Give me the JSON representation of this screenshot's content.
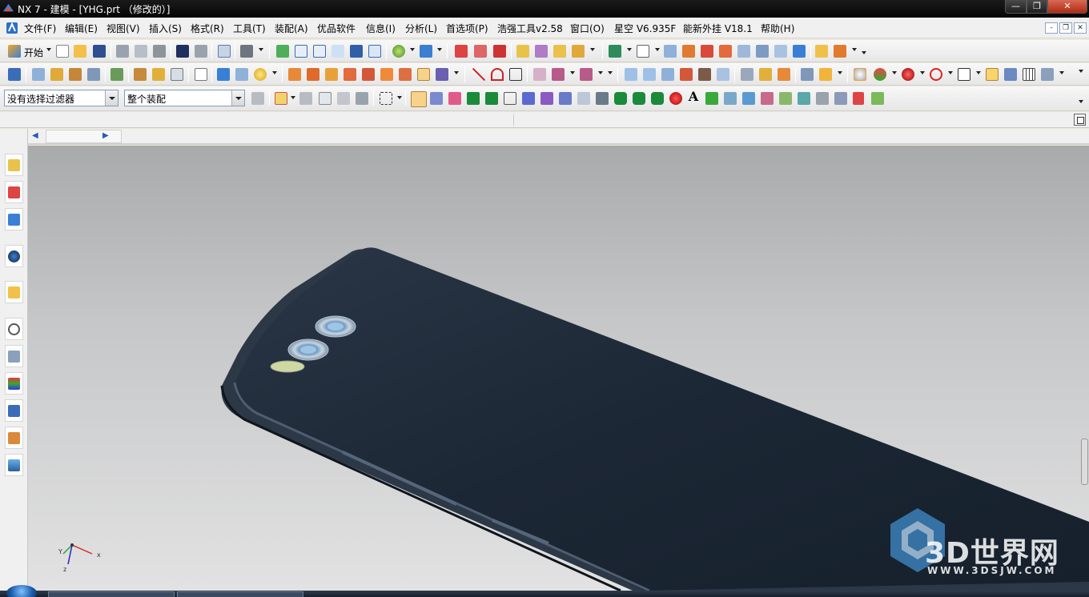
{
  "window": {
    "title": "NX 7 - 建模 - [YHG.prt （修改的）]",
    "min": "—",
    "max": "❐",
    "close": "✕"
  },
  "menu": {
    "items": [
      "文件(F)",
      "编辑(E)",
      "视图(V)",
      "插入(S)",
      "格式(R)",
      "工具(T)",
      "装配(A)",
      "优品软件",
      "信息(I)",
      "分析(L)",
      "首选项(P)",
      "浩强工具v2.58",
      "窗口(O)",
      "星空 V6.935F",
      "能新外挂 V18.1",
      "帮助(H)"
    ],
    "mdi": [
      "-",
      "❐",
      "✕"
    ]
  },
  "toolbar": {
    "start_label": "开始",
    "selection_filter": "没有选择过滤器",
    "assembly_scope": "整个装配"
  },
  "watermark": {
    "brand": "3D世界网",
    "url": "WWW.3DSJW.COM"
  },
  "triad": {
    "x": "x",
    "y": "Y",
    "z": "z"
  },
  "colors": {
    "titlebar": "#0a0a0a",
    "viewport_top": "#a9aaab",
    "viewport_bottom": "#e2e2e3",
    "phone_body": "#1d2836",
    "phone_edge": "#3b4a5a",
    "accent": "#2b5bb5"
  }
}
